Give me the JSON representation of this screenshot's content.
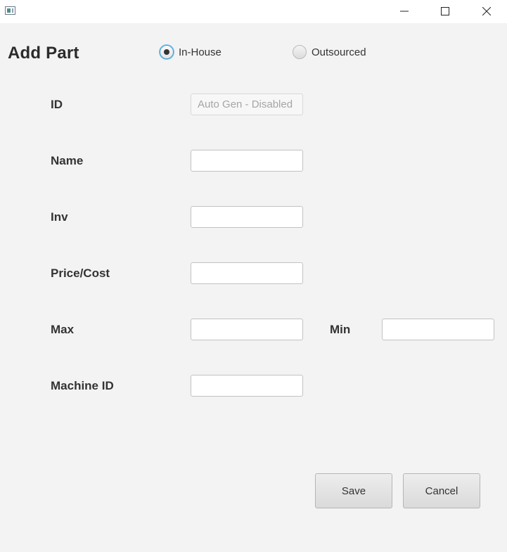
{
  "window": {
    "controls": {
      "minimize_icon": "minimize-icon",
      "maximize_icon": "maximize-icon",
      "close_icon": "close-icon"
    }
  },
  "form": {
    "title": "Add Part",
    "source_options": [
      {
        "label": "In-House",
        "selected": true
      },
      {
        "label": "Outsourced",
        "selected": false
      }
    ],
    "fields": {
      "id": {
        "label": "ID",
        "value": "",
        "placeholder": "Auto Gen - Disabled"
      },
      "name": {
        "label": "Name",
        "value": ""
      },
      "inv": {
        "label": "Inv",
        "value": ""
      },
      "price": {
        "label": "Price/Cost",
        "value": ""
      },
      "max": {
        "label": "Max",
        "value": ""
      },
      "min": {
        "label": "Min",
        "value": ""
      },
      "machine_id": {
        "label": "Machine ID",
        "value": ""
      }
    },
    "buttons": {
      "save": "Save",
      "cancel": "Cancel"
    }
  },
  "colors": {
    "accent": "#3a9ed5",
    "background": "#f3f3f3",
    "titlebar": "#ffffff"
  }
}
